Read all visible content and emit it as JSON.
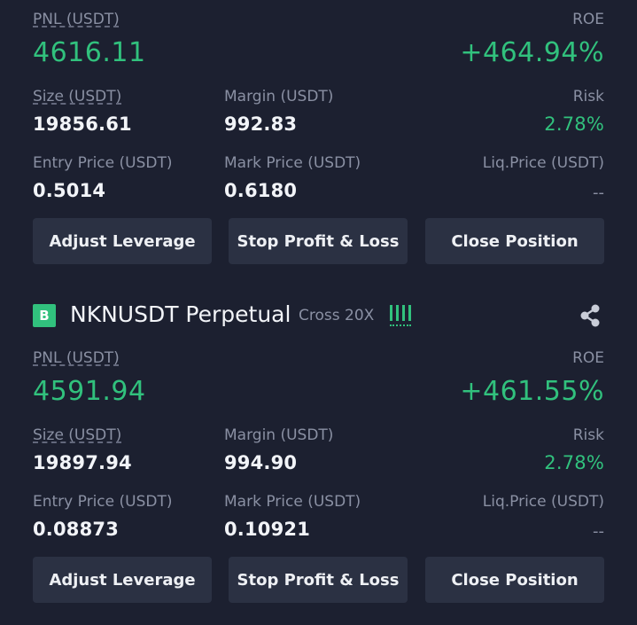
{
  "positions": [
    {
      "pnl_label": "PNL (USDT)",
      "pnl_value": "4616.11",
      "roe_label": "ROE",
      "roe_value": "+464.94%",
      "size_label": "Size (USDT)",
      "size_value": "19856.61",
      "margin_label": "Margin (USDT)",
      "margin_value": "992.83",
      "risk_label": "Risk",
      "risk_value": "2.78%",
      "entry_label": "Entry Price (USDT)",
      "entry_value": "0.5014",
      "mark_label": "Mark Price (USDT)",
      "mark_value": "0.6180",
      "liq_label": "Liq.Price (USDT)",
      "liq_value": "--",
      "buttons": {
        "adjust_leverage": "Adjust Leverage",
        "stop_profit_loss": "Stop Profit & Loss",
        "close_position": "Close Position"
      }
    },
    {
      "badge": "B",
      "symbol": "NKNUSDT Perpetual",
      "mode": "Cross 20X",
      "pnl_label": "PNL (USDT)",
      "pnl_value": "4591.94",
      "roe_label": "ROE",
      "roe_value": "+461.55%",
      "size_label": "Size (USDT)",
      "size_value": "19897.94",
      "margin_label": "Margin (USDT)",
      "margin_value": "994.90",
      "risk_label": "Risk",
      "risk_value": "2.78%",
      "entry_label": "Entry Price (USDT)",
      "entry_value": "0.08873",
      "mark_label": "Mark Price (USDT)",
      "mark_value": "0.10921",
      "liq_label": "Liq.Price (USDT)",
      "liq_value": "--",
      "buttons": {
        "adjust_leverage": "Adjust Leverage",
        "stop_profit_loss": "Stop Profit & Loss",
        "close_position": "Close Position"
      }
    }
  ],
  "colors": {
    "background": "#1c2030",
    "profit_green": "#31c17d",
    "button_bg": "#2b3143",
    "label_gray": "#8a90a3"
  },
  "icons": {
    "leverage_bars": "signal-bars-icon",
    "share": "share-icon"
  }
}
